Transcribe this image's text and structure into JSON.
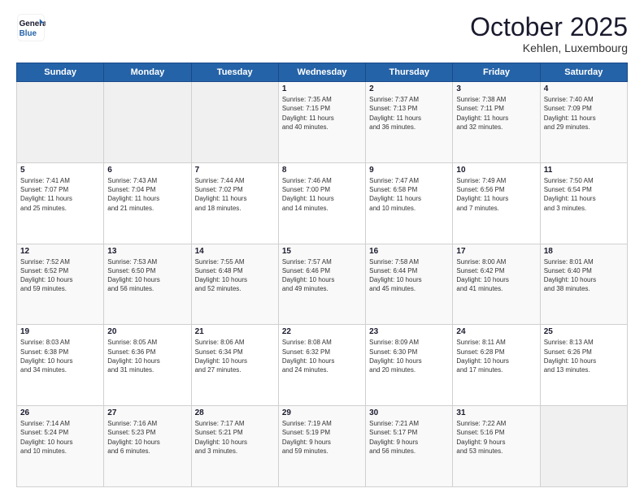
{
  "header": {
    "logo_line1": "General",
    "logo_line2": "Blue",
    "month_title": "October 2025",
    "location": "Kehlen, Luxembourg"
  },
  "weekdays": [
    "Sunday",
    "Monday",
    "Tuesday",
    "Wednesday",
    "Thursday",
    "Friday",
    "Saturday"
  ],
  "weeks": [
    [
      {
        "day": "",
        "info": ""
      },
      {
        "day": "",
        "info": ""
      },
      {
        "day": "",
        "info": ""
      },
      {
        "day": "1",
        "info": "Sunrise: 7:35 AM\nSunset: 7:15 PM\nDaylight: 11 hours\nand 40 minutes."
      },
      {
        "day": "2",
        "info": "Sunrise: 7:37 AM\nSunset: 7:13 PM\nDaylight: 11 hours\nand 36 minutes."
      },
      {
        "day": "3",
        "info": "Sunrise: 7:38 AM\nSunset: 7:11 PM\nDaylight: 11 hours\nand 32 minutes."
      },
      {
        "day": "4",
        "info": "Sunrise: 7:40 AM\nSunset: 7:09 PM\nDaylight: 11 hours\nand 29 minutes."
      }
    ],
    [
      {
        "day": "5",
        "info": "Sunrise: 7:41 AM\nSunset: 7:07 PM\nDaylight: 11 hours\nand 25 minutes."
      },
      {
        "day": "6",
        "info": "Sunrise: 7:43 AM\nSunset: 7:04 PM\nDaylight: 11 hours\nand 21 minutes."
      },
      {
        "day": "7",
        "info": "Sunrise: 7:44 AM\nSunset: 7:02 PM\nDaylight: 11 hours\nand 18 minutes."
      },
      {
        "day": "8",
        "info": "Sunrise: 7:46 AM\nSunset: 7:00 PM\nDaylight: 11 hours\nand 14 minutes."
      },
      {
        "day": "9",
        "info": "Sunrise: 7:47 AM\nSunset: 6:58 PM\nDaylight: 11 hours\nand 10 minutes."
      },
      {
        "day": "10",
        "info": "Sunrise: 7:49 AM\nSunset: 6:56 PM\nDaylight: 11 hours\nand 7 minutes."
      },
      {
        "day": "11",
        "info": "Sunrise: 7:50 AM\nSunset: 6:54 PM\nDaylight: 11 hours\nand 3 minutes."
      }
    ],
    [
      {
        "day": "12",
        "info": "Sunrise: 7:52 AM\nSunset: 6:52 PM\nDaylight: 10 hours\nand 59 minutes."
      },
      {
        "day": "13",
        "info": "Sunrise: 7:53 AM\nSunset: 6:50 PM\nDaylight: 10 hours\nand 56 minutes."
      },
      {
        "day": "14",
        "info": "Sunrise: 7:55 AM\nSunset: 6:48 PM\nDaylight: 10 hours\nand 52 minutes."
      },
      {
        "day": "15",
        "info": "Sunrise: 7:57 AM\nSunset: 6:46 PM\nDaylight: 10 hours\nand 49 minutes."
      },
      {
        "day": "16",
        "info": "Sunrise: 7:58 AM\nSunset: 6:44 PM\nDaylight: 10 hours\nand 45 minutes."
      },
      {
        "day": "17",
        "info": "Sunrise: 8:00 AM\nSunset: 6:42 PM\nDaylight: 10 hours\nand 41 minutes."
      },
      {
        "day": "18",
        "info": "Sunrise: 8:01 AM\nSunset: 6:40 PM\nDaylight: 10 hours\nand 38 minutes."
      }
    ],
    [
      {
        "day": "19",
        "info": "Sunrise: 8:03 AM\nSunset: 6:38 PM\nDaylight: 10 hours\nand 34 minutes."
      },
      {
        "day": "20",
        "info": "Sunrise: 8:05 AM\nSunset: 6:36 PM\nDaylight: 10 hours\nand 31 minutes."
      },
      {
        "day": "21",
        "info": "Sunrise: 8:06 AM\nSunset: 6:34 PM\nDaylight: 10 hours\nand 27 minutes."
      },
      {
        "day": "22",
        "info": "Sunrise: 8:08 AM\nSunset: 6:32 PM\nDaylight: 10 hours\nand 24 minutes."
      },
      {
        "day": "23",
        "info": "Sunrise: 8:09 AM\nSunset: 6:30 PM\nDaylight: 10 hours\nand 20 minutes."
      },
      {
        "day": "24",
        "info": "Sunrise: 8:11 AM\nSunset: 6:28 PM\nDaylight: 10 hours\nand 17 minutes."
      },
      {
        "day": "25",
        "info": "Sunrise: 8:13 AM\nSunset: 6:26 PM\nDaylight: 10 hours\nand 13 minutes."
      }
    ],
    [
      {
        "day": "26",
        "info": "Sunrise: 7:14 AM\nSunset: 5:24 PM\nDaylight: 10 hours\nand 10 minutes."
      },
      {
        "day": "27",
        "info": "Sunrise: 7:16 AM\nSunset: 5:23 PM\nDaylight: 10 hours\nand 6 minutes."
      },
      {
        "day": "28",
        "info": "Sunrise: 7:17 AM\nSunset: 5:21 PM\nDaylight: 10 hours\nand 3 minutes."
      },
      {
        "day": "29",
        "info": "Sunrise: 7:19 AM\nSunset: 5:19 PM\nDaylight: 9 hours\nand 59 minutes."
      },
      {
        "day": "30",
        "info": "Sunrise: 7:21 AM\nSunset: 5:17 PM\nDaylight: 9 hours\nand 56 minutes."
      },
      {
        "day": "31",
        "info": "Sunrise: 7:22 AM\nSunset: 5:16 PM\nDaylight: 9 hours\nand 53 minutes."
      },
      {
        "day": "",
        "info": ""
      }
    ]
  ]
}
